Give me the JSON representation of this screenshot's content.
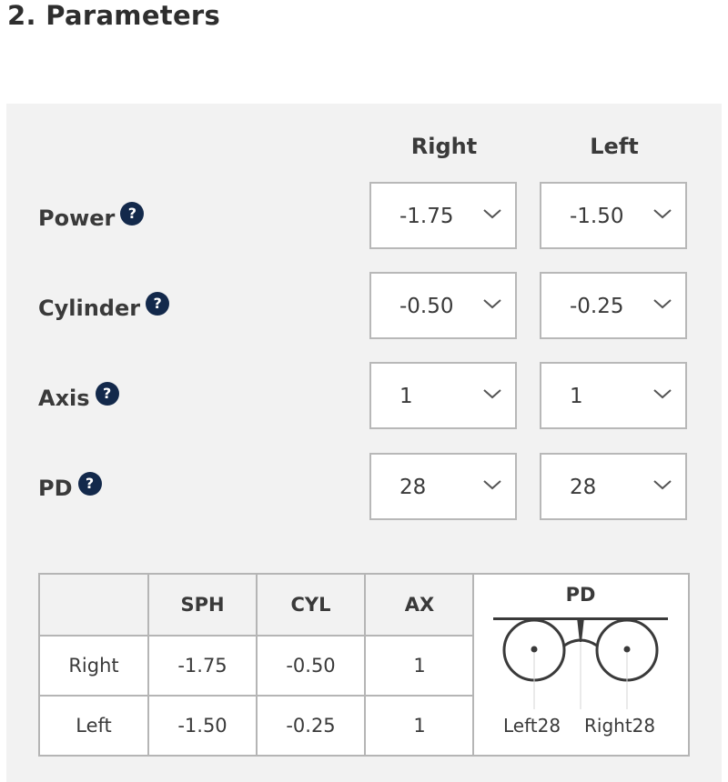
{
  "section": {
    "title": "2. Parameters"
  },
  "columns": {
    "right": "Right",
    "left": "Left"
  },
  "params": [
    {
      "label": "Power",
      "help": "?",
      "right": "-1.75",
      "left": "-1.50"
    },
    {
      "label": "Cylinder",
      "help": "?",
      "right": "-0.50",
      "left": "-0.25"
    },
    {
      "label": "Axis",
      "help": "?",
      "right": "1",
      "left": "1"
    },
    {
      "label": "PD",
      "help": "?",
      "right": "28",
      "left": "28"
    }
  ],
  "summary": {
    "headers": [
      "",
      "SPH",
      "CYL",
      "AX"
    ],
    "rows": [
      {
        "eye": "Right",
        "sph": "-1.75",
        "cyl": "-0.50",
        "ax": "1"
      },
      {
        "eye": "Left",
        "sph": "-1.50",
        "cyl": "-0.25",
        "ax": "1"
      }
    ],
    "pd": {
      "title": "PD",
      "left_label": "Left28",
      "right_label": "Right28"
    }
  },
  "icons": {
    "help": "question-circle-icon",
    "dropdown": "chevron-down-icon",
    "glasses": "glasses-pd-diagram-icon"
  },
  "colors": {
    "help_icon_bg": "#13294b",
    "panel_bg": "#f2f2f2",
    "border": "#b8b8b8"
  }
}
